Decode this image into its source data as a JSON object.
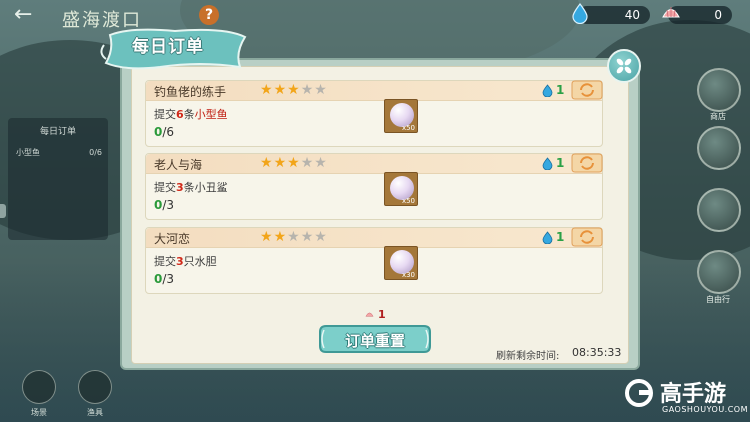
{
  "topbar": {
    "place_title": "盛海渡口",
    "help_label": "?",
    "water_count": "40",
    "shell_count": "0"
  },
  "left_panel": {
    "title": "每日订单",
    "rows": [
      {
        "label": "小型鱼",
        "value": "0/6"
      },
      {
        "label": "",
        "value": ""
      },
      {
        "label": "",
        "value": ""
      }
    ]
  },
  "side_buttons": [
    "商店",
    "",
    "",
    "自由行"
  ],
  "bottom_buttons": [
    "场景",
    "渔具"
  ],
  "panel": {
    "tab_title": "每日订单",
    "orders": [
      {
        "title": "钓鱼佬的练手",
        "stars_filled": 3,
        "stars_total": 5,
        "reward": "1",
        "task_prefix": "提交",
        "task_num": "6",
        "task_mid": "条",
        "task_item": "小型鱼",
        "task_item_highlight": true,
        "progress_current": "0",
        "progress_total": "/6",
        "item_count": "x50"
      },
      {
        "title": "老人与海",
        "stars_filled": 3,
        "stars_total": 5,
        "reward": "1",
        "task_prefix": "提交",
        "task_num": "3",
        "task_mid": "条",
        "task_item": "小丑鲨",
        "task_item_highlight": false,
        "progress_current": "0",
        "progress_total": "/3",
        "item_count": "x50"
      },
      {
        "title": "大河恋",
        "stars_filled": 2,
        "stars_total": 5,
        "reward": "1",
        "task_prefix": "提交",
        "task_num": "3",
        "task_mid": "只",
        "task_item": "水胆",
        "task_item_highlight": false,
        "progress_current": "0",
        "progress_total": "/3",
        "item_count": "x30"
      }
    ],
    "reset_cost": "1",
    "reset_label": "订单重置",
    "refresh_label": "刷新剩余时间:",
    "refresh_time": "08:35:33"
  },
  "watermark": {
    "brand": "高手游",
    "url": "GAOSHOUYOU.COM"
  },
  "colors": {
    "accent_teal": "#4aa3a6",
    "highlight_red": "#d12a1a",
    "progress_green": "#2a9a3a",
    "star_gold": "#f2a51a"
  }
}
